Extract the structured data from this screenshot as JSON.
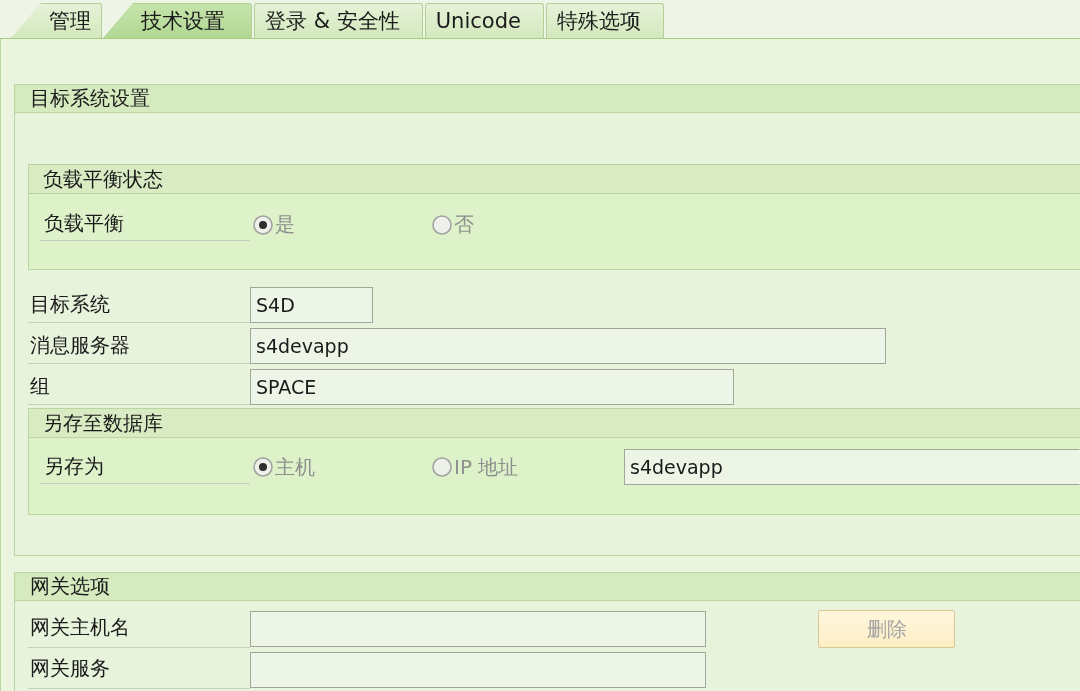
{
  "tabs": [
    {
      "label": "管理",
      "selected": false
    },
    {
      "label": "技术设置",
      "selected": true
    },
    {
      "label": "登录 & 安全性",
      "selected": false
    },
    {
      "label": "Unicode",
      "selected": false
    },
    {
      "label": "特殊选项",
      "selected": false
    }
  ],
  "target_system_settings": {
    "title": "目标系统设置",
    "load_balancing_status": {
      "title": "负载平衡状态",
      "label": "负载平衡",
      "options": [
        {
          "label": "是",
          "selected": true,
          "disabled": true
        },
        {
          "label": "否",
          "selected": false,
          "disabled": true
        }
      ]
    },
    "fields": [
      {
        "label": "目标系统",
        "value": "S4D"
      },
      {
        "label": "消息服务器",
        "value": "s4devapp"
      },
      {
        "label": "组",
        "value": "SPACE"
      }
    ],
    "save_to_database": {
      "title": "另存至数据库",
      "label": "另存为",
      "options": [
        {
          "label": "主机",
          "selected": true,
          "disabled": true
        },
        {
          "label": "IP 地址",
          "selected": false,
          "disabled": true
        }
      ],
      "value": "s4devapp"
    }
  },
  "gateway_options": {
    "title": "网关选项",
    "fields": [
      {
        "label": "网关主机名"
      },
      {
        "label": "网关服务"
      }
    ],
    "button": {
      "label": "删除",
      "disabled": true
    }
  }
}
